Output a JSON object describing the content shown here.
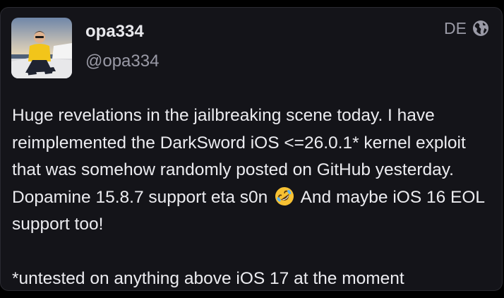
{
  "post": {
    "display_name": "opa334",
    "handle": "@opa334",
    "language": "DE",
    "language_icon": "globe-icon",
    "body_line1_before_emoji": "Huge revelations in the jailbreaking scene today. I have reimplemented the DarkSword iOS <=26.0.1* kernel exploit that was somehow randomly posted on GitHub yesterday. Dopamine 15.8.7 support eta s0n",
    "emoji": "rolling-on-the-floor-laughing-emoji",
    "body_line1_after_emoji": "And maybe iOS 16 EOL support too!",
    "footnote": "*untested on anything above iOS 17 at the moment"
  },
  "colors": {
    "card_background": "#141419",
    "text_primary": "#ececf0",
    "text_secondary": "#9a9aa6"
  }
}
